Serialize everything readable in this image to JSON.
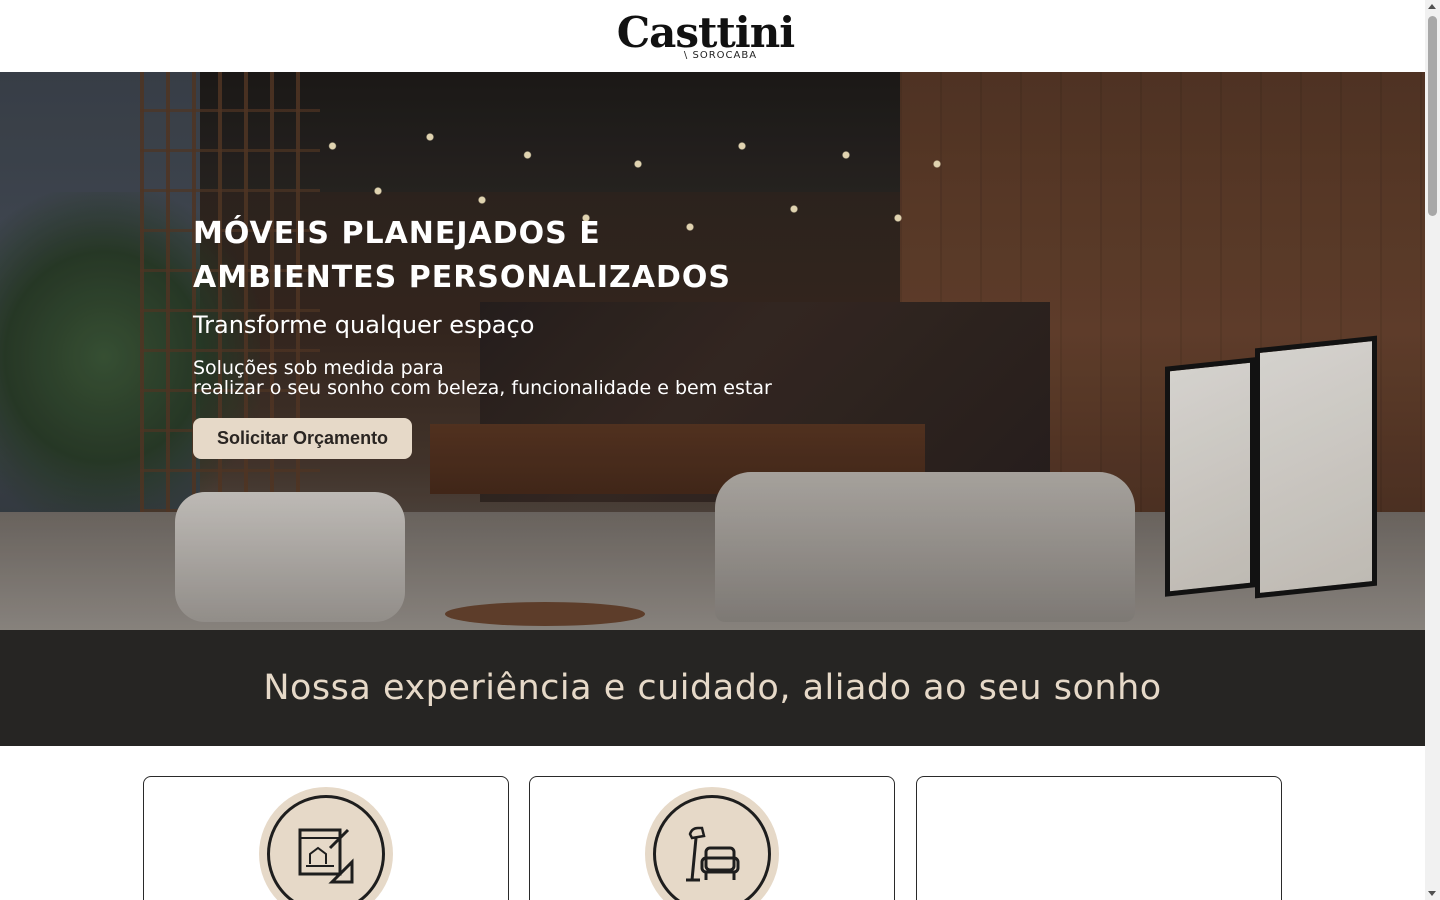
{
  "header": {
    "logo_text": "Casttini",
    "logo_subtext": "\\ SOROCABA"
  },
  "hero": {
    "title_line1": "MÓVEIS PLANEJADOS E",
    "title_line2": "AMBIENTES PERSONALIZADOS",
    "subtitle": "Transforme qualquer espaço",
    "description_line1": "Soluções sob medida para",
    "description_line2": "realizar o seu sonho com beleza, funcionalidade e bem estar",
    "cta_label": "Solicitar Orçamento",
    "image": "lobby-interior-photo"
  },
  "band": {
    "title": "Nossa experiência e cuidado, aliado ao seu sonho"
  },
  "cards": [
    {
      "icon": "blueprint-design-icon"
    },
    {
      "icon": "armchair-lamp-icon"
    },
    {
      "icon": ""
    }
  ],
  "colors": {
    "accent_beige": "#e6d9c8",
    "dark_band": "#262523",
    "text_dark": "#2a2522"
  }
}
